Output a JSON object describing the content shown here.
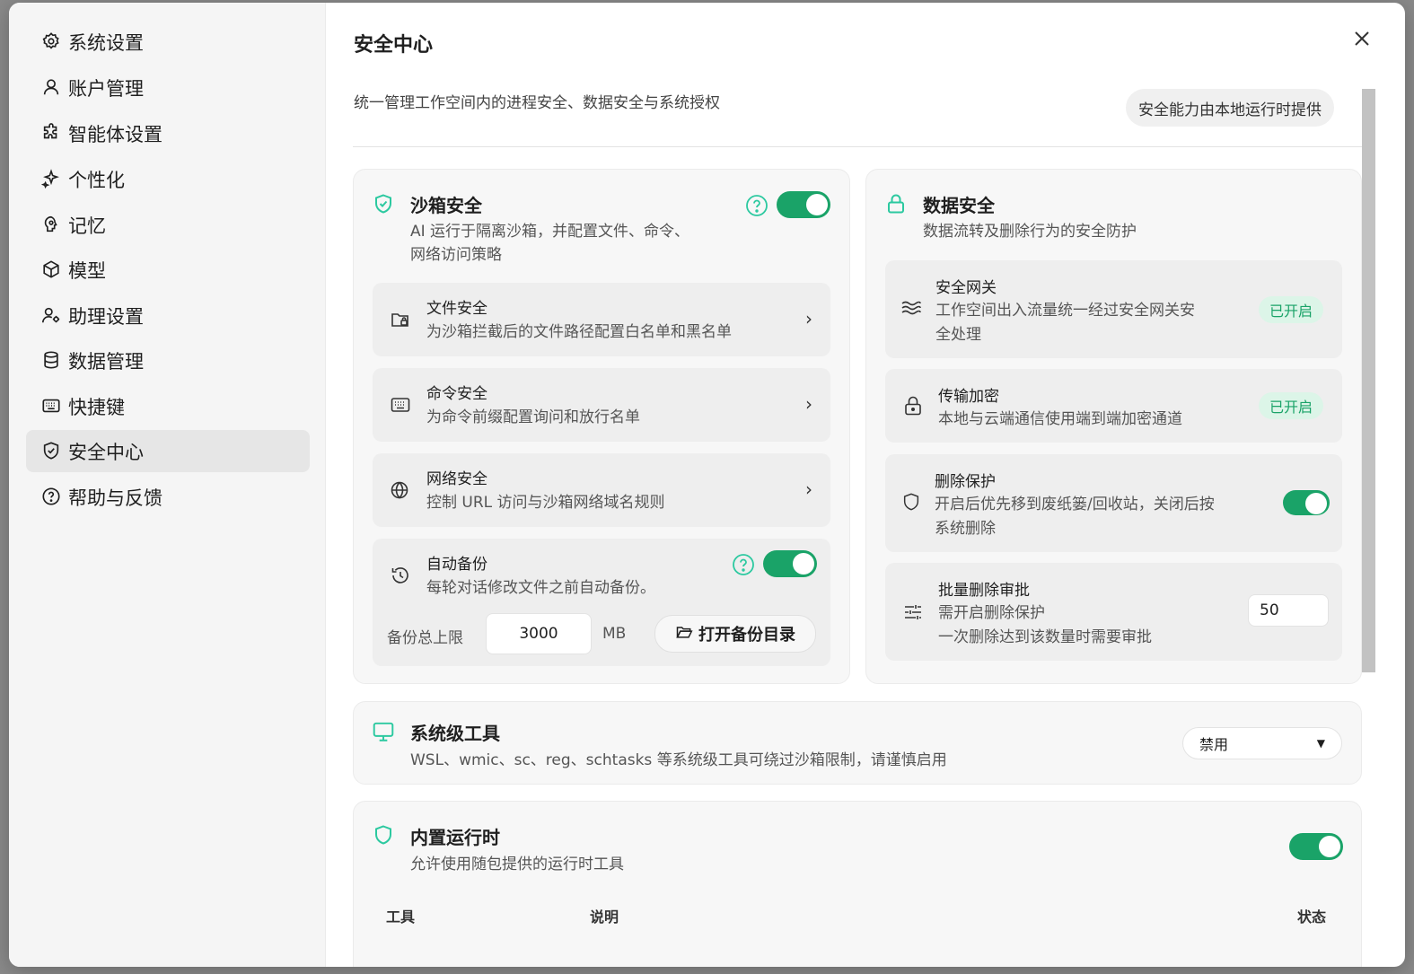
{
  "sidebar": {
    "items": [
      {
        "label": "系统设置",
        "icon": "gear-icon"
      },
      {
        "label": "账户管理",
        "icon": "user-icon"
      },
      {
        "label": "智能体设置",
        "icon": "puzzle-icon"
      },
      {
        "label": "个性化",
        "icon": "sparkle-icon"
      },
      {
        "label": "记忆",
        "icon": "brain-icon"
      },
      {
        "label": "模型",
        "icon": "cube-icon"
      },
      {
        "label": "助理设置",
        "icon": "user-gear-icon"
      },
      {
        "label": "数据管理",
        "icon": "database-icon"
      },
      {
        "label": "快捷键",
        "icon": "keyboard-icon"
      },
      {
        "label": "安全中心",
        "icon": "shield-check-icon"
      },
      {
        "label": "帮助与反馈",
        "icon": "help-icon"
      }
    ],
    "active": "安全中心"
  },
  "page": {
    "title": "安全中心",
    "description": "统一管理工作空间内的进程安全、数据安全与系统授权",
    "runtime_badge": "安全能力由本地运行时提供"
  },
  "sandbox": {
    "title": "沙箱安全",
    "subtitle_line1": "AI 运行于隔离沙箱，并配置文件、命令、",
    "subtitle_line2": "网络访问策略",
    "enabled": true,
    "items": [
      {
        "title": "文件安全",
        "desc": "为沙箱拦截后的文件路径配置白名单和黑名单"
      },
      {
        "title": "命令安全",
        "desc": "为命令前缀配置询问和放行名单"
      },
      {
        "title": "网络安全",
        "desc": "控制 URL 访问与沙箱网络域名规则"
      }
    ],
    "backup": {
      "title": "自动备份",
      "desc": "每轮对话修改文件之前自动备份。",
      "enabled": true,
      "limit_label": "备份总上限",
      "limit_value": "3000",
      "limit_unit": "MB",
      "open_button": "打开备份目录"
    }
  },
  "data_security": {
    "title": "数据安全",
    "subtitle": "数据流转及删除行为的安全防护",
    "gateway": {
      "title": "安全网关",
      "desc_line1": "工作空间出入流量统一经过安全网关安",
      "desc_line2": "全处理",
      "status": "已开启"
    },
    "encryption": {
      "title": "传输加密",
      "desc": "本地与云端通信使用端到端加密通道",
      "status": "已开启"
    },
    "delete_protect": {
      "title": "删除保护",
      "desc_line1": "开启后优先移到废纸篓/回收站，关闭后按",
      "desc_line2": "系统删除",
      "enabled": true
    },
    "batch_delete": {
      "title": "批量删除审批",
      "desc_line1": "需开启删除保护",
      "desc_line2": "一次删除达到该数量时需要审批",
      "value": "50"
    }
  },
  "system_tools": {
    "title": "系统级工具",
    "desc": "WSL、wmic、sc、reg、schtasks 等系统级工具可绕过沙箱限制，请谨慎启用",
    "select_value": "禁用"
  },
  "builtin_runtime": {
    "title": "内置运行时",
    "desc": "允许使用随包提供的运行时工具",
    "enabled": true,
    "columns": [
      "工具",
      "说明",
      "状态"
    ]
  },
  "colors": {
    "accent": "#1aa368",
    "icon_teal": "#2cc9a0",
    "badge_bg": "#dcf5e8"
  }
}
